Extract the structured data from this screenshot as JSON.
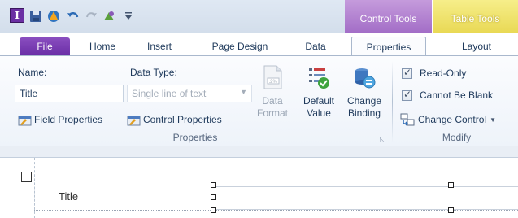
{
  "quick_access": {
    "icons": [
      "app-icon",
      "save-icon",
      "logo-icon",
      "undo-icon",
      "redo-icon",
      "format-painter-icon",
      "customize-icon"
    ],
    "app_glyph": "I"
  },
  "context_tabs": {
    "control_tools": "Control Tools",
    "table_tools": "Table Tools",
    "control_color": "#a36ec7",
    "table_color": "#e9d955"
  },
  "tabs": [
    {
      "label": "File",
      "selected": false
    },
    {
      "label": "Home",
      "selected": false
    },
    {
      "label": "Insert",
      "selected": false
    },
    {
      "label": "Page Design",
      "selected": false
    },
    {
      "label": "Data",
      "selected": false
    },
    {
      "label": "Properties",
      "selected": true
    },
    {
      "label": "Layout",
      "selected": false
    }
  ],
  "ribbon": {
    "properties_group": {
      "name_label": "Name:",
      "name_value": "Title",
      "data_type_label": "Data Type:",
      "data_type_value": "Single line of text",
      "field_properties": "Field Properties",
      "control_properties": "Control Properties",
      "data_format": [
        "Data",
        "Format"
      ],
      "default_value": [
        "Default",
        "Value"
      ],
      "change_binding": [
        "Change",
        "Binding"
      ],
      "group_label": "Properties"
    },
    "modify_group": {
      "read_only": {
        "label": "Read-Only",
        "checked": true
      },
      "cannot_be_blank": {
        "label": "Cannot Be Blank",
        "checked": true
      },
      "change_control": "Change Control",
      "group_label": "Modify"
    }
  },
  "canvas": {
    "field_label": "Title"
  }
}
